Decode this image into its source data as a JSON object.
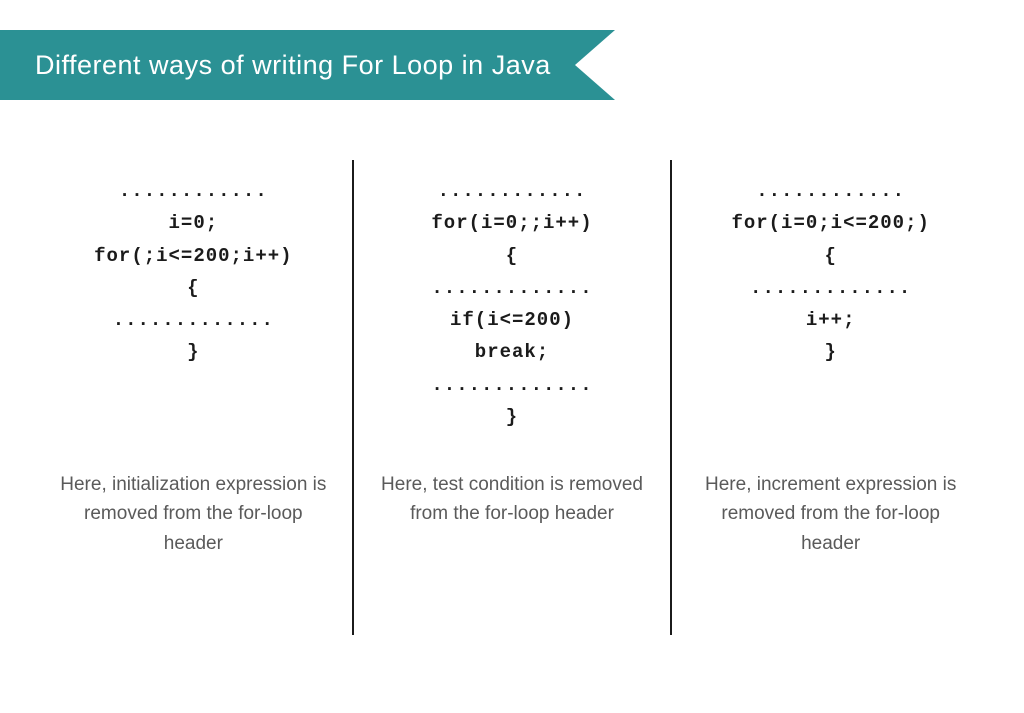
{
  "banner": {
    "title": "Different ways of writing For Loop in Java",
    "bg": "#2b9194",
    "fg": "#ffffff"
  },
  "columns": [
    {
      "code": [
        "............",
        "i=0;",
        "for(;i<=200;i++)",
        "{",
        ".............",
        "}"
      ],
      "caption": "Here, initialization expression is removed from the for-loop header"
    },
    {
      "code": [
        "............",
        "for(i=0;;i++)",
        "{",
        ".............",
        "if(i<=200)",
        "break;",
        ".............",
        "}"
      ],
      "caption": "Here, test condition is removed from the for-loop header"
    },
    {
      "code": [
        "............",
        "for(i=0;i<=200;)",
        "{",
        ".............",
        "i++;",
        "}"
      ],
      "caption": "Here, increment expression is removed from the for-loop header"
    }
  ]
}
